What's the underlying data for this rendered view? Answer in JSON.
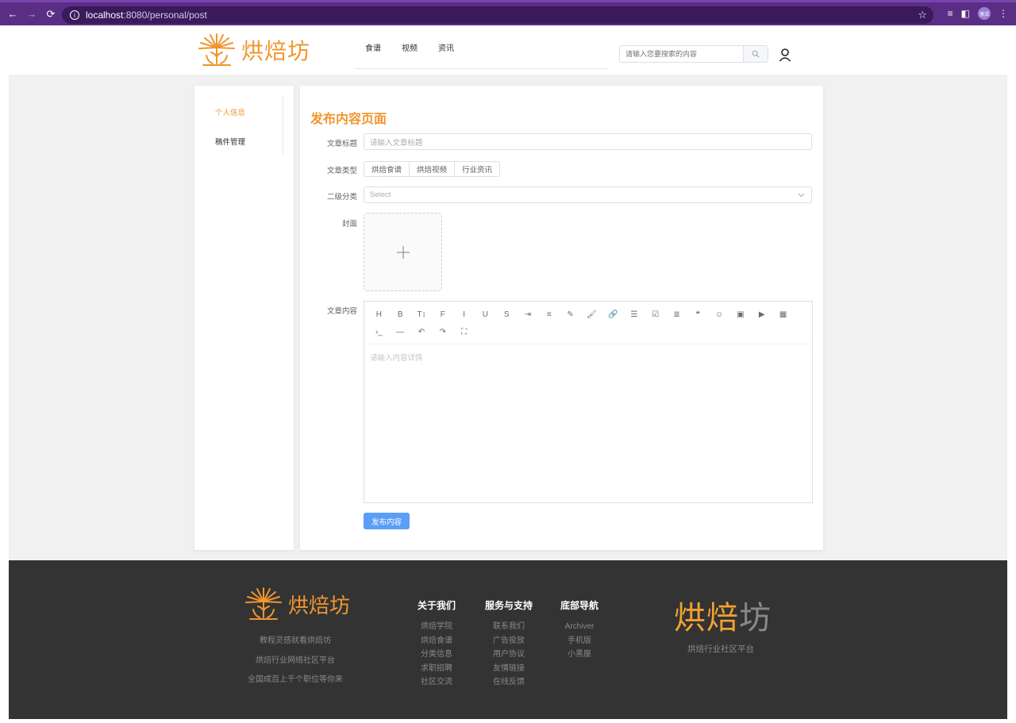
{
  "browser": {
    "url_host": "localhost",
    "url_path": ":8080/personal/post",
    "profile_badge": "激活"
  },
  "header": {
    "logo_text": "烘焙坊",
    "nav": [
      "食谱",
      "视频",
      "资讯"
    ],
    "search_placeholder": "请输入您要搜索的内容"
  },
  "sidebar": {
    "items": [
      {
        "label": "个人信息",
        "active": true
      },
      {
        "label": "稿件管理",
        "active": false
      }
    ]
  },
  "form": {
    "page_title": "发布内容页面",
    "title_label": "文章标题",
    "title_placeholder": "请输入文章标题",
    "type_label": "文章类型",
    "type_options": [
      "烘焙食谱",
      "烘焙视频",
      "行业资讯"
    ],
    "subcat_label": "二级分类",
    "subcat_placeholder": "Select",
    "cover_label": "封面",
    "content_label": "文章内容",
    "content_placeholder": "请输入内容详情",
    "submit_label": "发布内容"
  },
  "editor_toolbar": {
    "tools": [
      "heading-icon",
      "bold-icon",
      "text-size-icon",
      "font-icon",
      "italic-icon",
      "underline-icon",
      "strikethrough-icon",
      "indent-icon",
      "line-height-icon",
      "highlight-icon",
      "brush-icon",
      "link-icon",
      "list-icon",
      "checkbox-icon",
      "align-icon",
      "quote-icon",
      "emoji-icon",
      "image-icon",
      "video-icon",
      "table-icon",
      "code-icon",
      "divider-icon",
      "undo-icon",
      "redo-icon",
      "fullscreen-icon"
    ],
    "glyphs": [
      "H",
      "B",
      "T↕",
      "F",
      "I",
      "U",
      "S",
      "⇥",
      "≡",
      "✎",
      "🖌",
      "🔗",
      "☰",
      "☑",
      "≣",
      "❝",
      "☺",
      "▣",
      "▶",
      "▦",
      "›_",
      "—",
      "↶",
      "↷",
      "⛶"
    ]
  },
  "footer": {
    "logo_text": "烘焙坊",
    "tagline_lines": [
      "教程灵感就看烘焙坊",
      "烘焙行业网络社区平台",
      "全国成百上千个职位等你来"
    ],
    "columns": [
      {
        "title": "关于我们",
        "links": [
          "烘焙学院",
          "烘焙食谱",
          "分类信息",
          "求职招聘",
          "社区交流"
        ]
      },
      {
        "title": "服务与支持",
        "links": [
          "联系我们",
          "广告投放",
          "用户协议",
          "友情链接",
          "在线反馈"
        ]
      },
      {
        "title": "底部导航",
        "links": [
          "Archiver",
          "手机版",
          "小黑屋"
        ]
      }
    ],
    "big_logo_part1": "烘焙",
    "big_logo_part2": "坊",
    "big_subtitle": "烘焙行业社区平台"
  },
  "colors": {
    "brand_orange": "#f0962e",
    "primary_blue": "#5b9ef8",
    "footer_bg": "#333333",
    "chrome_purple": "#5b2e86"
  }
}
